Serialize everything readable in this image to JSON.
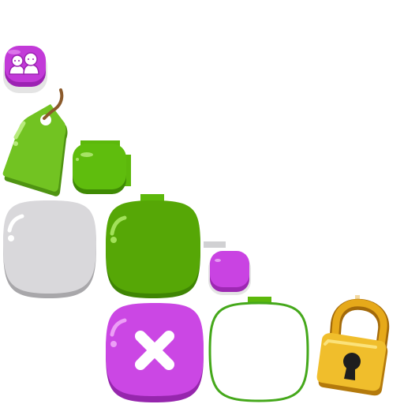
{
  "sprite_sheet": {
    "sprites": [
      {
        "id": "friends-button",
        "icon": "two-friends-icon",
        "color": "#c23ad8"
      },
      {
        "id": "price-tag",
        "icon": "price-tag-icon",
        "color": "#6cc11f"
      },
      {
        "id": "green-button-small",
        "color": "#5cb80b"
      },
      {
        "id": "grey-button-large",
        "color": "#d8d7da"
      },
      {
        "id": "green-button-large",
        "color": "#56a706"
      },
      {
        "id": "purple-button-small",
        "color": "#c943e2"
      },
      {
        "id": "close-button",
        "icon": "close-icon",
        "color": "#cb47e4"
      },
      {
        "id": "outline-frame",
        "color": "#45a81b"
      },
      {
        "id": "padlock",
        "icon": "lock-icon",
        "color": "#e6a91a"
      }
    ]
  }
}
